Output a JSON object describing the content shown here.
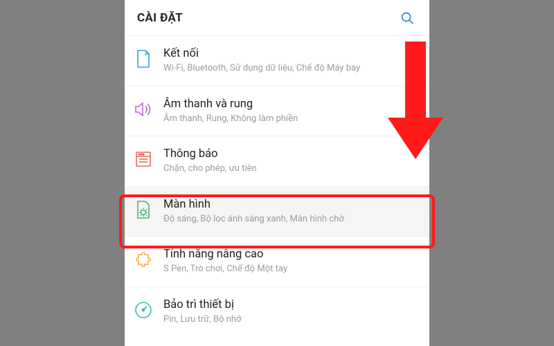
{
  "header": {
    "title": "CÀI ĐẶT"
  },
  "items": [
    {
      "title": "Kết nối",
      "sub": "Wi-Fi, Bluetooth, Sử dụng dữ liệu, Chế độ Máy bay",
      "icon": "sim",
      "color": "#2aa8d8"
    },
    {
      "title": "Âm thanh và rung",
      "sub": "Âm thanh, Rung, Không làm phiền",
      "icon": "sound",
      "color": "#b96ad8"
    },
    {
      "title": "Thông báo",
      "sub": "Chặn, cho phép, ưu tiên",
      "icon": "notif",
      "color": "#e26e5a"
    },
    {
      "title": "Màn hình",
      "sub": "Độ sáng, Bộ lọc ánh sáng xanh, Màn hình chờ",
      "icon": "display",
      "color": "#4fb86a",
      "selected": true
    },
    {
      "title": "Tính năng nâng cao",
      "sub": "S Pen, Trò chơi, Chế độ Một tay",
      "icon": "advanced",
      "color": "#f0a94a"
    },
    {
      "title": "Bảo trì thiết bị",
      "sub": "Pin, Lưu trữ, Bộ nhớ",
      "icon": "maint",
      "color": "#33bfa8"
    }
  ],
  "annotations": {
    "highlight_index": 3,
    "arrow_color": "#ff1a1a"
  }
}
